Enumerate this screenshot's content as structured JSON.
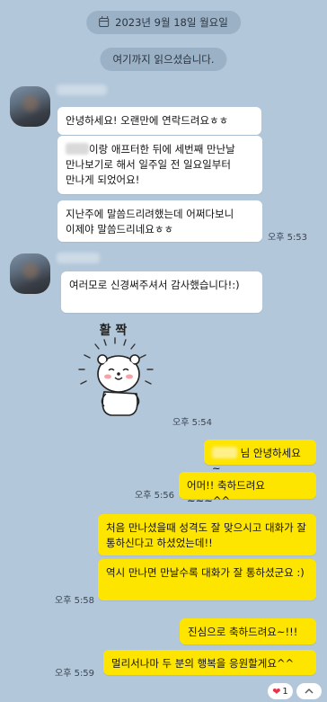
{
  "date_divider": "2023년 9월 18일 월요일",
  "read_marker": "여기까지 읽으셨습니다.",
  "group1": {
    "messages": [
      "안녕하세요! 오랜만에 연락드려요ㅎㅎ",
      "이랑 애프터한 뒤에 세번째 만난날 만나보기로 해서 일주일 전 일요일부터 만나게 되었어요!",
      "지난주에 말씀드리려했는데 어쩌다보니 이제야 말씀드리네요ㅎㅎ"
    ],
    "time": "오후 5:53"
  },
  "group2": {
    "message": "여러모로 신경써주셔서 감사했습니다!:)",
    "sticker_text": "활 짝",
    "time": "오후 5:54"
  },
  "outgoing": [
    {
      "text": "님 안녕하세요~",
      "time": ""
    },
    {
      "text": "어머!! 축하드려요~~~^^",
      "time": "오후 5:56"
    },
    {
      "text": "처음 만나셨을때 성격도 잘 맞으시고 대화가 잘 통하신다고 하셨었는데!!",
      "time": ""
    },
    {
      "text": "역시 만나면 만날수록 대화가 잘 통하셨군요 :)",
      "time": "오후 5:58"
    },
    {
      "text": "진심으로 축하드려요~!!!",
      "time": ""
    },
    {
      "text": "멀리서나마 두 분의 행복을 응원할게요^^",
      "time": "오후 5:59"
    }
  ],
  "reaction": {
    "count": "1",
    "icon": "heart-icon"
  },
  "colors": {
    "background": "#b2c7da",
    "incoming": "#ffffff",
    "outgoing": "#fee500"
  }
}
